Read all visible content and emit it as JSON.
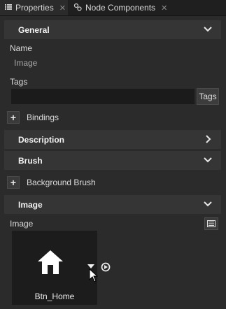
{
  "tabs": [
    {
      "label": "Properties",
      "icon": "list-icon",
      "active": true
    },
    {
      "label": "Node Components",
      "icon": "node-components-icon",
      "active": false
    }
  ],
  "general": {
    "title": "General",
    "name_label": "Name",
    "name_value": "Image",
    "tags_label": "Tags",
    "tags_value": "",
    "tags_button": "Tags",
    "bindings_label": "Bindings"
  },
  "description": {
    "title": "Description"
  },
  "brush": {
    "title": "Brush",
    "background_label": "Background Brush"
  },
  "image_section": {
    "title": "Image",
    "image_label": "Image",
    "asset_name": "Btn_Home"
  }
}
